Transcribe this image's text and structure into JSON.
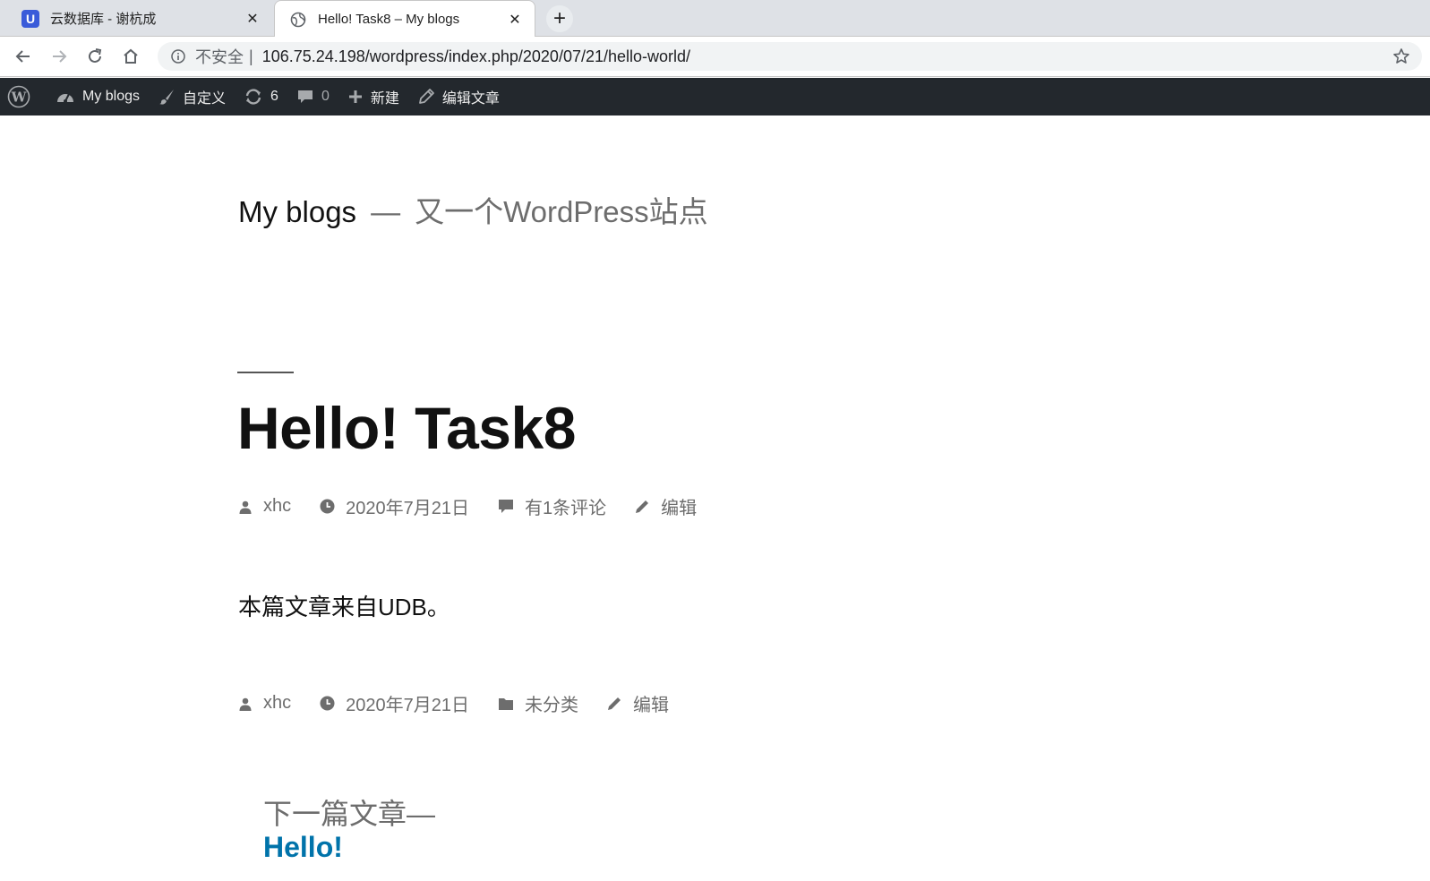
{
  "browser": {
    "tabs": [
      {
        "title": "云数据库 - 谢杭成",
        "icon": "u-logo-icon",
        "active": false
      },
      {
        "title": "Hello! Task8 – My blogs",
        "icon": "globe-icon",
        "active": true
      }
    ],
    "address": {
      "security_label": "不安全",
      "separator": "|",
      "url": "106.75.24.198/wordpress/index.php/2020/07/21/hello-world/"
    }
  },
  "adminbar": {
    "site_name": "My blogs",
    "customize": "自定义",
    "updates_count": "6",
    "comments_count": "0",
    "new": "新建",
    "edit_post": "编辑文章"
  },
  "site": {
    "title": "My blogs",
    "dash": "—",
    "description": "又一个WordPress站点"
  },
  "post": {
    "title": "Hello! Task8",
    "meta_top": {
      "author": "xhc",
      "date": "2020年7月21日",
      "comments": "有1条评论",
      "edit": "编辑"
    },
    "body": "本篇文章来自UDB。",
    "meta_bottom": {
      "author": "xhc",
      "date": "2020年7月21日",
      "category": "未分类",
      "edit": "编辑"
    }
  },
  "post_nav": {
    "next_label": "下一篇文章—",
    "next_title": "Hello!"
  },
  "colors": {
    "adminbar_bg": "#23282d",
    "link": "#0073aa",
    "meta_gray": "#6d6d6d"
  }
}
